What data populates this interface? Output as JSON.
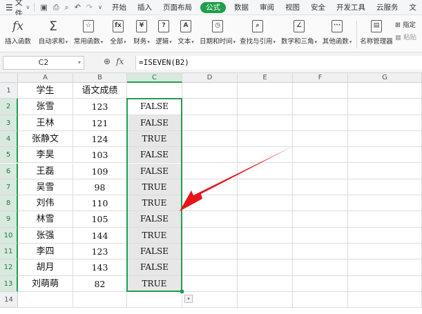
{
  "menubar": {
    "file_label": "文件",
    "tabs": [
      "开始",
      "插入",
      "页面布局",
      "公式",
      "数据",
      "审阅",
      "视图",
      "安全",
      "开发工具",
      "云服务",
      "文"
    ],
    "active_tab": "公式"
  },
  "ribbon": {
    "insert_function": "插入函数",
    "autosum": "自动求和",
    "common": "常用函数",
    "all": "全部",
    "finance": "财务",
    "logic": "逻辑",
    "text": "文本",
    "datetime": "日期和时间",
    "lookup": "查找与引用",
    "math": "数学和三角",
    "other": "其他函数",
    "name_manager": "名称管理器",
    "specify": "指定",
    "paste": "粘贴"
  },
  "formula_bar": {
    "cell_ref": "C2",
    "formula": "=ISEVEN(B2)"
  },
  "columns": [
    "A",
    "B",
    "C",
    "D",
    "E",
    "F",
    "G"
  ],
  "rows": [
    {
      "n": "1",
      "a": "学生",
      "b": "语文成绩",
      "c": ""
    },
    {
      "n": "2",
      "a": "张雪",
      "b": "123",
      "c": "FALSE"
    },
    {
      "n": "3",
      "a": "王林",
      "b": "121",
      "c": "FALSE"
    },
    {
      "n": "4",
      "a": "张静文",
      "b": "124",
      "c": "TRUE"
    },
    {
      "n": "5",
      "a": "李昊",
      "b": "103",
      "c": "FALSE"
    },
    {
      "n": "6",
      "a": "王磊",
      "b": "109",
      "c": "FALSE"
    },
    {
      "n": "7",
      "a": "吴雪",
      "b": "98",
      "c": "TRUE"
    },
    {
      "n": "8",
      "a": "刘伟",
      "b": "110",
      "c": "TRUE"
    },
    {
      "n": "9",
      "a": "林雪",
      "b": "105",
      "c": "FALSE"
    },
    {
      "n": "10",
      "a": "张强",
      "b": "144",
      "c": "TRUE"
    },
    {
      "n": "11",
      "a": "李四",
      "b": "123",
      "c": "FALSE"
    },
    {
      "n": "12",
      "a": "胡月",
      "b": "143",
      "c": "FALSE"
    },
    {
      "n": "13",
      "a": "刘萌萌",
      "b": "82",
      "c": "TRUE"
    },
    {
      "n": "14",
      "a": "",
      "b": "",
      "c": ""
    }
  ],
  "colors": {
    "accent_green": "#1f9e4d",
    "arrow_red": "#e8141c"
  }
}
